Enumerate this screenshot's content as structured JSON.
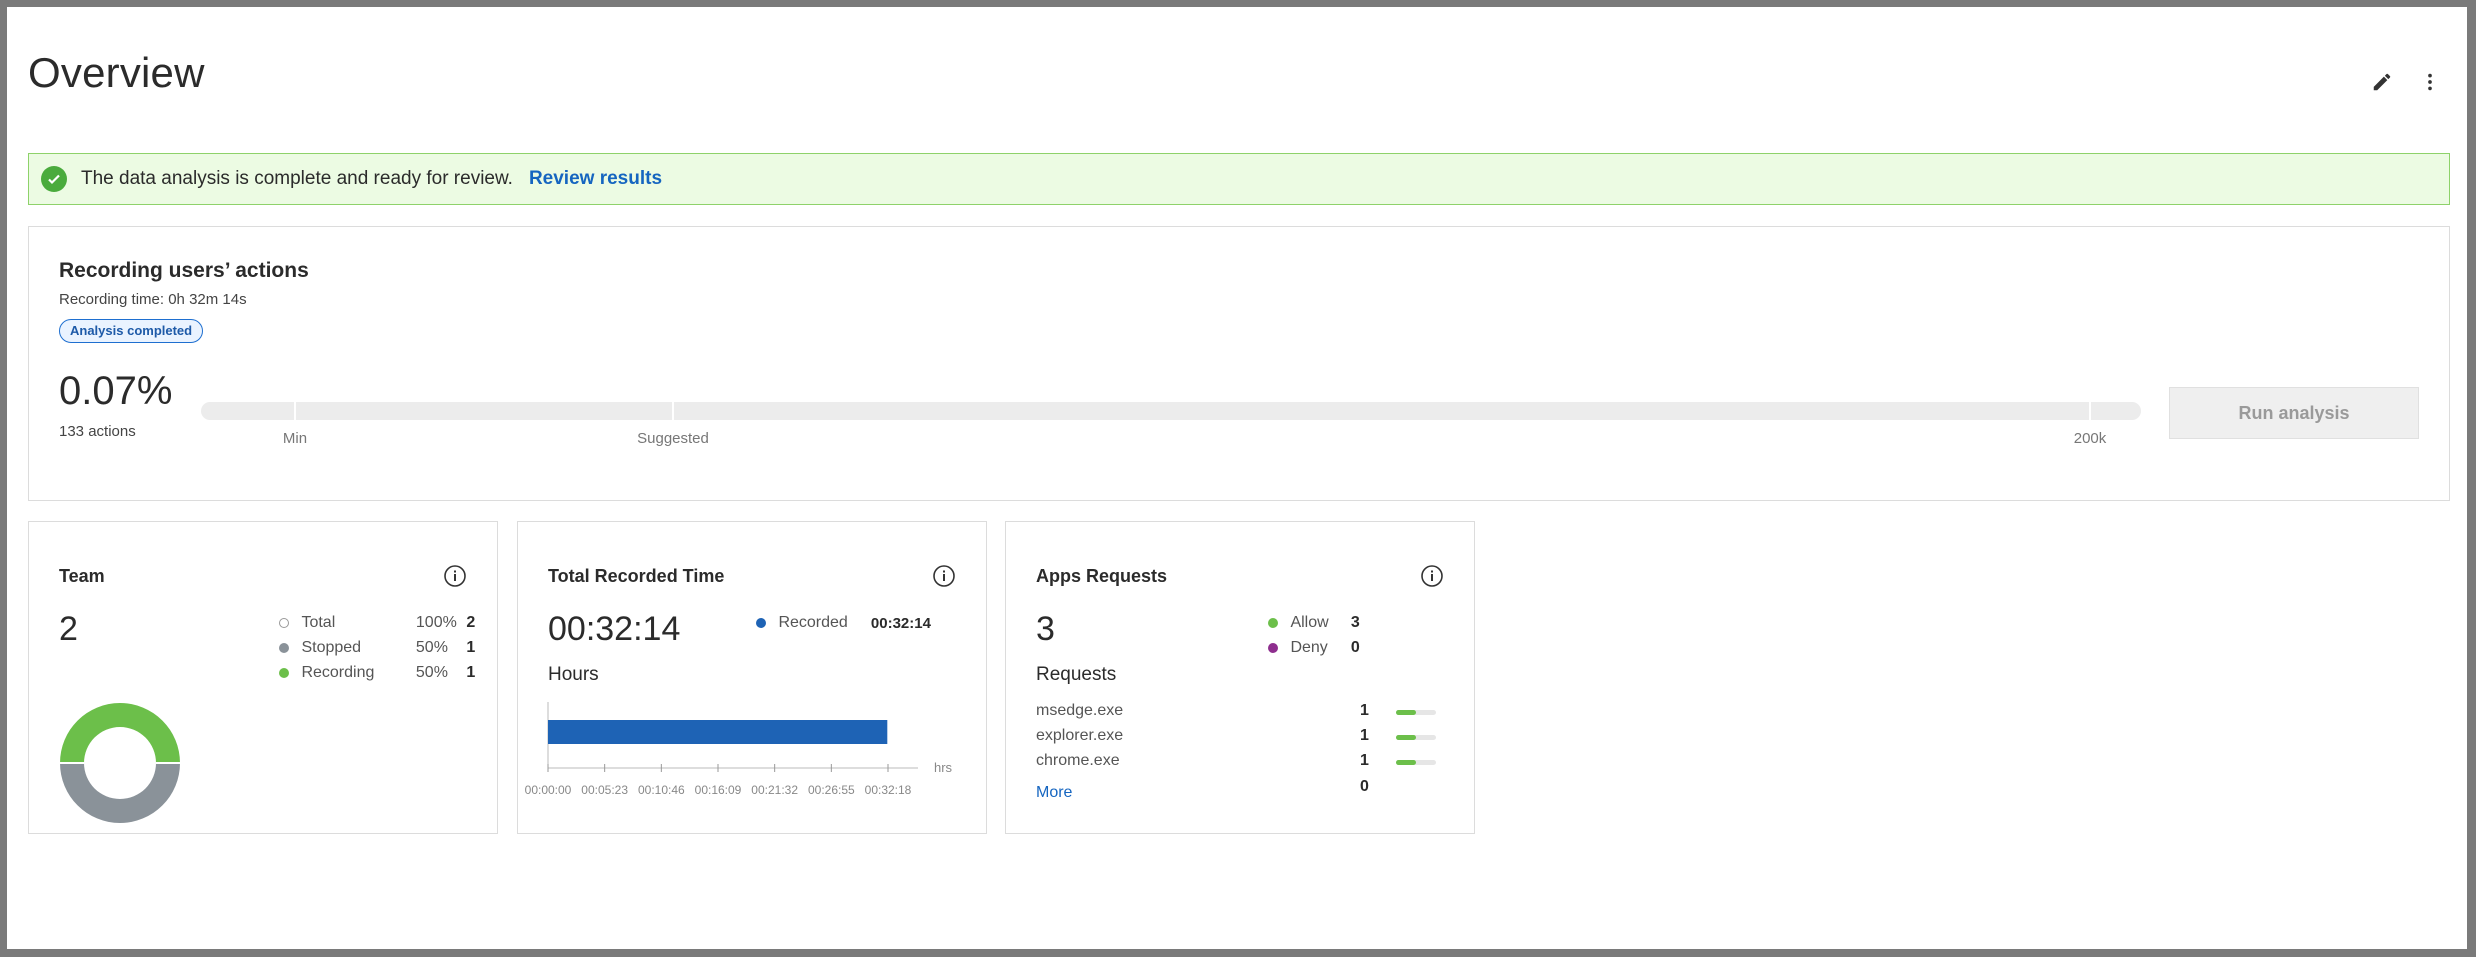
{
  "header": {
    "title": "Overview",
    "edit_icon": "pencil-icon",
    "menu_icon": "more-vertical-icon"
  },
  "banner": {
    "icon": "check-circle-icon",
    "message": "The data analysis is complete and ready for review.",
    "link_label": "Review results",
    "bg_color": "#ecfbe3",
    "border_color": "#8ed26a"
  },
  "recording": {
    "title": "Recording users’ actions",
    "time": "Recording time: 0h 32m 14s",
    "badge": "Analysis completed",
    "percent": "0.07%",
    "actions": "133 actions",
    "slider_labels": [
      "Min",
      "Suggested",
      "200k"
    ],
    "run_button": "Run analysis"
  },
  "team": {
    "title": "Team",
    "count": "2",
    "legend": [
      {
        "label": "Total",
        "pct": "100%",
        "value": "2",
        "color": "#ffffff"
      },
      {
        "label": "Stopped",
        "pct": "50%",
        "value": "1",
        "color": "#8a9299"
      },
      {
        "label": "Recording",
        "pct": "50%",
        "value": "1",
        "color": "#6cbf4a"
      }
    ],
    "donut": {
      "recording_fraction": 0.5,
      "stopped_fraction": 0.5
    }
  },
  "recorded_time": {
    "title": "Total Recorded Time",
    "value": "00:32:14",
    "legend_label": "Recorded",
    "legend_value": "00:32:14",
    "legend_color": "#1e63b5",
    "axis_caption": "Hours",
    "unit": "hrs",
    "ticks": [
      "00:00:00",
      "00:05:23",
      "00:10:46",
      "00:16:09",
      "00:21:32",
      "00:26:55",
      "00:32:18"
    ]
  },
  "apps": {
    "title": "Apps Requests",
    "count": "3",
    "requests_label": "Requests",
    "legend": [
      {
        "label": "Allow",
        "value": "3",
        "color": "#6cbf4a"
      },
      {
        "label": "Deny",
        "value": "0",
        "color": "#8e2e8e"
      }
    ],
    "rows": [
      {
        "name": "msedge.exe",
        "count": "1",
        "fraction": 0.5
      },
      {
        "name": "explorer.exe",
        "count": "1",
        "fraction": 0.5
      },
      {
        "name": "chrome.exe",
        "count": "1",
        "fraction": 0.5
      }
    ],
    "more_label": "More",
    "more_count": "0"
  },
  "chart_data": {
    "type": "bar",
    "categories": [
      "Recorded"
    ],
    "values": [
      0.5372
    ],
    "xlabel": "hrs",
    "ylabel": "",
    "xlim": [
      0,
      0.5383
    ],
    "orientation": "horizontal"
  }
}
